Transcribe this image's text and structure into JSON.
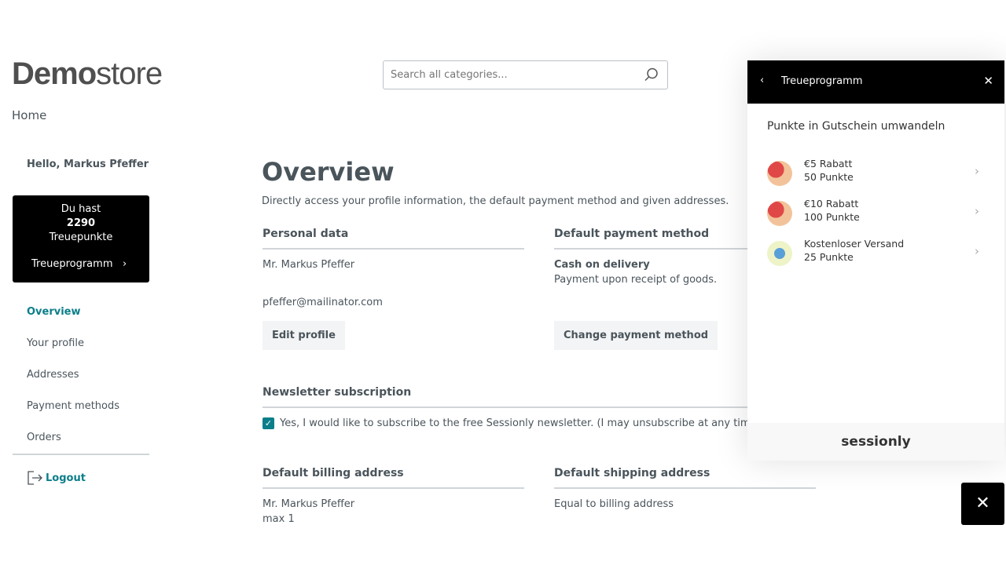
{
  "header": {
    "logo_bold": "Demo",
    "logo_light": "store",
    "search_placeholder": "Search all categories...",
    "breadcrumb": "Home"
  },
  "sidebar": {
    "greeting": "Hello, Markus Pfeffer",
    "points_box": {
      "line1": "Du hast",
      "points": "2290",
      "line3": "Treuepunkte",
      "link": "Treueprogramm"
    },
    "items": [
      {
        "label": "Overview",
        "active": true
      },
      {
        "label": "Your profile"
      },
      {
        "label": "Addresses"
      },
      {
        "label": "Payment methods"
      },
      {
        "label": "Orders"
      }
    ],
    "logout": "Logout"
  },
  "main": {
    "title": "Overview",
    "intro": "Directly access your profile information, the default payment method and given addresses.",
    "personal": {
      "heading": "Personal data",
      "name": "Mr. Markus Pfeffer",
      "email": "pfeffer@mailinator.com",
      "button": "Edit profile"
    },
    "payment": {
      "heading": "Default payment method",
      "method": "Cash on delivery",
      "desc": "Payment upon receipt of goods.",
      "button": "Change payment method"
    },
    "newsletter": {
      "heading": "Newsletter subscription",
      "checked": true,
      "label": "Yes, I would like to subscribe to the free Sessionly newsletter. (I may unsubscribe at any time.)"
    },
    "billing": {
      "heading": "Default billing address",
      "line1": "Mr. Markus Pfeffer",
      "line2": "max 1"
    },
    "shipping": {
      "heading": "Default shipping address",
      "text": "Equal to billing address"
    }
  },
  "panel": {
    "title": "Treueprogramm",
    "subtitle": "Punkte in Gutschein umwandeln",
    "rewards": [
      {
        "name": "€5 Rabatt",
        "cost": "50 Punkte",
        "icon": "money-bag-hand-icon"
      },
      {
        "name": "€10 Rabatt",
        "cost": "100 Punkte",
        "icon": "money-bag-hand-icon"
      },
      {
        "name": "Kostenloser Versand",
        "cost": "25 Punkte",
        "icon": "truck-icon"
      }
    ],
    "brand": "sessionly"
  },
  "colors": {
    "accent": "#0b7e8a",
    "panel_header": "#000000"
  }
}
